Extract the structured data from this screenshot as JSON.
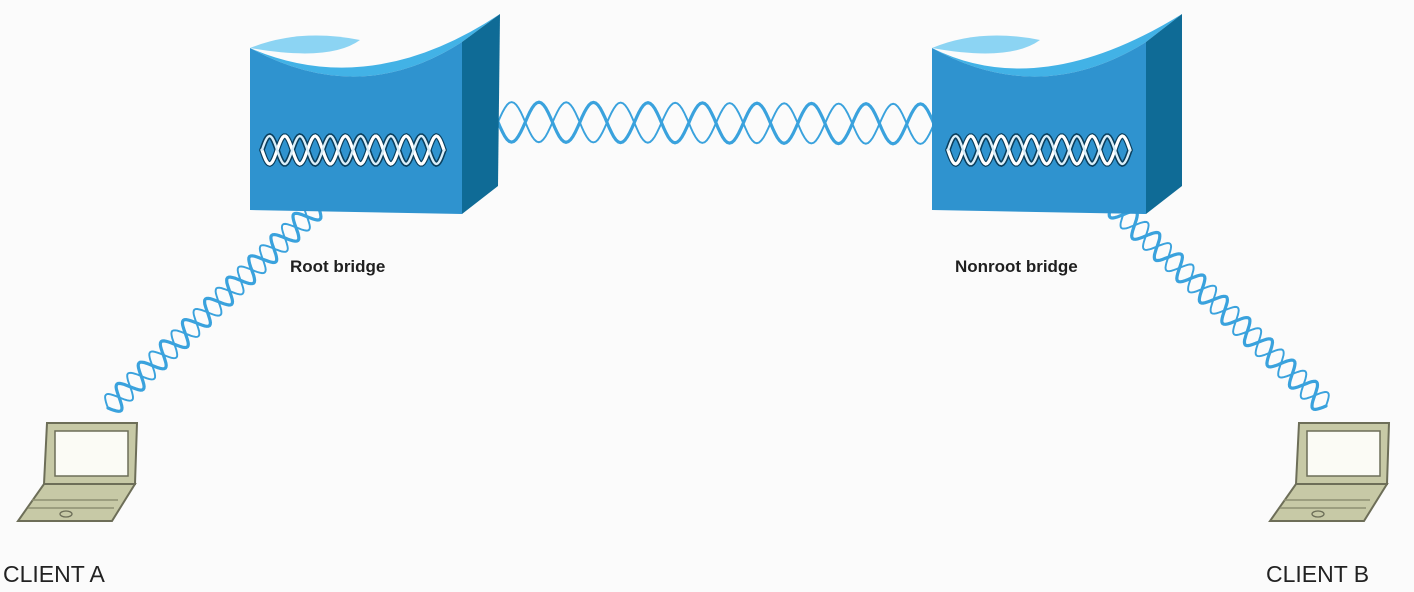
{
  "colors": {
    "background": "#fbfbfb",
    "bridge_face": "#2f93cf",
    "bridge_top": "#42b2e6",
    "bridge_side": "#0f6b96",
    "wireless_link": "#3aa2dd",
    "laptop_body": "#c7c9a6",
    "laptop_outline": "#6d6e58"
  },
  "icons": {
    "root_bridge": "wireless-bridge-icon",
    "nonroot_bridge": "wireless-bridge-icon",
    "client_a": "laptop-icon",
    "client_b": "laptop-icon"
  },
  "labels": {
    "root_bridge": "Root bridge",
    "nonroot_bridge": "Nonroot bridge",
    "client_a": "CLIENT A",
    "client_b": "CLIENT B"
  }
}
